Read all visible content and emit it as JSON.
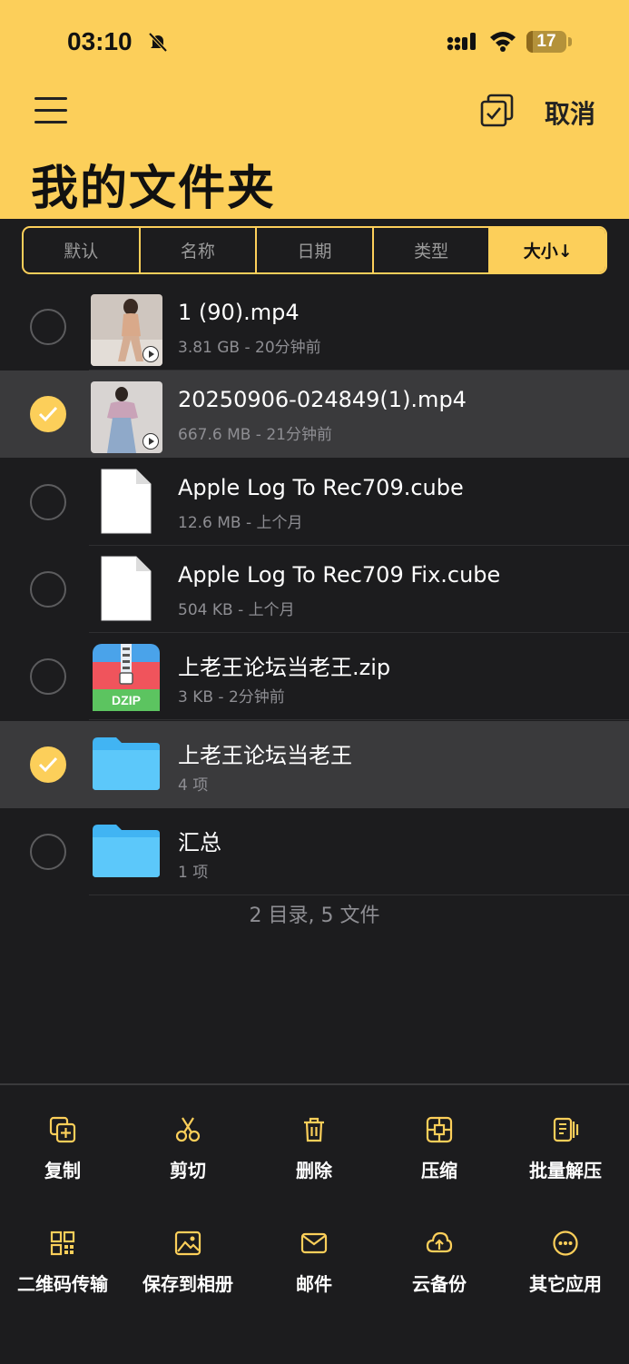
{
  "status_bar": {
    "time": "03:10",
    "battery": "17",
    "battery_level": 0.17
  },
  "header": {
    "cancel_label": "取消",
    "title": "我的文件夹"
  },
  "sort_tabs": [
    {
      "label": "默认",
      "active": false
    },
    {
      "label": "名称",
      "active": false
    },
    {
      "label": "日期",
      "active": false
    },
    {
      "label": "类型",
      "active": false
    },
    {
      "label": "大小↓",
      "active": true
    }
  ],
  "files": [
    {
      "name": "1 (90).mp4",
      "meta": "3.81 GB - 20分钟前",
      "selected": false,
      "icon": "video-thumbnail"
    },
    {
      "name": "20250906-024849(1).mp4",
      "meta": "667.6 MB - 21分钟前",
      "selected": true,
      "icon": "video-thumbnail"
    },
    {
      "name": "Apple Log To Rec709.cube",
      "meta": "12.6 MB - 上个月",
      "selected": false,
      "icon": "document-icon"
    },
    {
      "name": "Apple Log To Rec709 Fix.cube",
      "meta": "504 KB - 上个月",
      "selected": false,
      "icon": "document-icon"
    },
    {
      "name": "上老王论坛当老王.zip",
      "meta": "3 KB - 2分钟前",
      "selected": false,
      "icon": "zip-icon",
      "icon_text": "DZIP"
    },
    {
      "name": "上老王论坛当老王",
      "meta": "4 项",
      "selected": true,
      "icon": "folder-icon"
    },
    {
      "name": "汇总",
      "meta": "1 项",
      "selected": false,
      "icon": "folder-icon"
    }
  ],
  "summary": "2 目录, 5 文件",
  "toolbar": [
    {
      "label": "复制",
      "icon": "copy-icon"
    },
    {
      "label": "剪切",
      "icon": "scissors-icon"
    },
    {
      "label": "删除",
      "icon": "trash-icon"
    },
    {
      "label": "压缩",
      "icon": "compress-icon"
    },
    {
      "label": "批量解压",
      "icon": "batch-extract-icon"
    },
    {
      "label": "二维码传输",
      "icon": "qrcode-icon"
    },
    {
      "label": "保存到相册",
      "icon": "photo-icon"
    },
    {
      "label": "邮件",
      "icon": "mail-icon"
    },
    {
      "label": "云备份",
      "icon": "cloud-upload-icon"
    },
    {
      "label": "其它应用",
      "icon": "more-icon"
    }
  ],
  "colors": {
    "accent": "#fccf5a",
    "background": "#1c1c1e",
    "selected_row": "#3a3a3c"
  }
}
